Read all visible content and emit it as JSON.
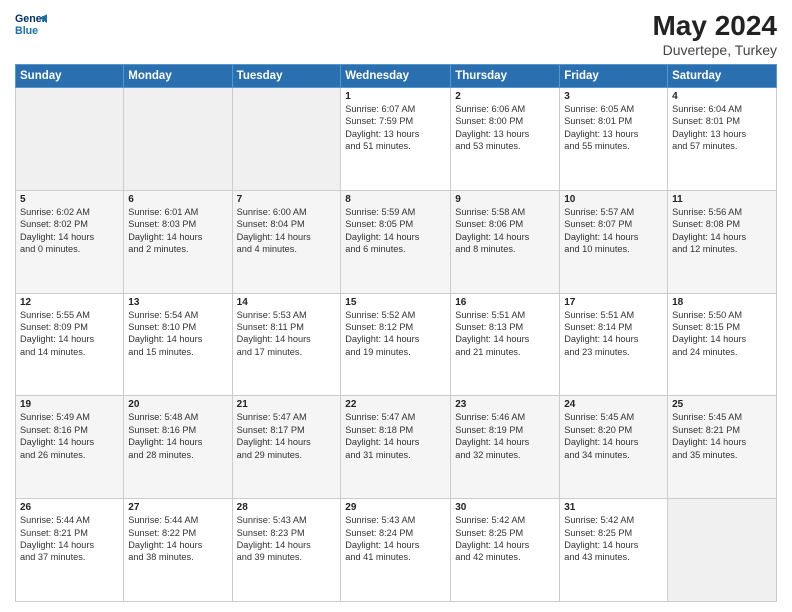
{
  "header": {
    "logo_line1": "General",
    "logo_line2": "Blue",
    "title": "May 2024",
    "location": "Duvertepe, Turkey"
  },
  "columns": [
    "Sunday",
    "Monday",
    "Tuesday",
    "Wednesday",
    "Thursday",
    "Friday",
    "Saturday"
  ],
  "weeks": [
    [
      {
        "day": "",
        "info": ""
      },
      {
        "day": "",
        "info": ""
      },
      {
        "day": "",
        "info": ""
      },
      {
        "day": "1",
        "info": "Sunrise: 6:07 AM\nSunset: 7:59 PM\nDaylight: 13 hours\nand 51 minutes."
      },
      {
        "day": "2",
        "info": "Sunrise: 6:06 AM\nSunset: 8:00 PM\nDaylight: 13 hours\nand 53 minutes."
      },
      {
        "day": "3",
        "info": "Sunrise: 6:05 AM\nSunset: 8:01 PM\nDaylight: 13 hours\nand 55 minutes."
      },
      {
        "day": "4",
        "info": "Sunrise: 6:04 AM\nSunset: 8:01 PM\nDaylight: 13 hours\nand 57 minutes."
      }
    ],
    [
      {
        "day": "5",
        "info": "Sunrise: 6:02 AM\nSunset: 8:02 PM\nDaylight: 14 hours\nand 0 minutes."
      },
      {
        "day": "6",
        "info": "Sunrise: 6:01 AM\nSunset: 8:03 PM\nDaylight: 14 hours\nand 2 minutes."
      },
      {
        "day": "7",
        "info": "Sunrise: 6:00 AM\nSunset: 8:04 PM\nDaylight: 14 hours\nand 4 minutes."
      },
      {
        "day": "8",
        "info": "Sunrise: 5:59 AM\nSunset: 8:05 PM\nDaylight: 14 hours\nand 6 minutes."
      },
      {
        "day": "9",
        "info": "Sunrise: 5:58 AM\nSunset: 8:06 PM\nDaylight: 14 hours\nand 8 minutes."
      },
      {
        "day": "10",
        "info": "Sunrise: 5:57 AM\nSunset: 8:07 PM\nDaylight: 14 hours\nand 10 minutes."
      },
      {
        "day": "11",
        "info": "Sunrise: 5:56 AM\nSunset: 8:08 PM\nDaylight: 14 hours\nand 12 minutes."
      }
    ],
    [
      {
        "day": "12",
        "info": "Sunrise: 5:55 AM\nSunset: 8:09 PM\nDaylight: 14 hours\nand 14 minutes."
      },
      {
        "day": "13",
        "info": "Sunrise: 5:54 AM\nSunset: 8:10 PM\nDaylight: 14 hours\nand 15 minutes."
      },
      {
        "day": "14",
        "info": "Sunrise: 5:53 AM\nSunset: 8:11 PM\nDaylight: 14 hours\nand 17 minutes."
      },
      {
        "day": "15",
        "info": "Sunrise: 5:52 AM\nSunset: 8:12 PM\nDaylight: 14 hours\nand 19 minutes."
      },
      {
        "day": "16",
        "info": "Sunrise: 5:51 AM\nSunset: 8:13 PM\nDaylight: 14 hours\nand 21 minutes."
      },
      {
        "day": "17",
        "info": "Sunrise: 5:51 AM\nSunset: 8:14 PM\nDaylight: 14 hours\nand 23 minutes."
      },
      {
        "day": "18",
        "info": "Sunrise: 5:50 AM\nSunset: 8:15 PM\nDaylight: 14 hours\nand 24 minutes."
      }
    ],
    [
      {
        "day": "19",
        "info": "Sunrise: 5:49 AM\nSunset: 8:16 PM\nDaylight: 14 hours\nand 26 minutes."
      },
      {
        "day": "20",
        "info": "Sunrise: 5:48 AM\nSunset: 8:16 PM\nDaylight: 14 hours\nand 28 minutes."
      },
      {
        "day": "21",
        "info": "Sunrise: 5:47 AM\nSunset: 8:17 PM\nDaylight: 14 hours\nand 29 minutes."
      },
      {
        "day": "22",
        "info": "Sunrise: 5:47 AM\nSunset: 8:18 PM\nDaylight: 14 hours\nand 31 minutes."
      },
      {
        "day": "23",
        "info": "Sunrise: 5:46 AM\nSunset: 8:19 PM\nDaylight: 14 hours\nand 32 minutes."
      },
      {
        "day": "24",
        "info": "Sunrise: 5:45 AM\nSunset: 8:20 PM\nDaylight: 14 hours\nand 34 minutes."
      },
      {
        "day": "25",
        "info": "Sunrise: 5:45 AM\nSunset: 8:21 PM\nDaylight: 14 hours\nand 35 minutes."
      }
    ],
    [
      {
        "day": "26",
        "info": "Sunrise: 5:44 AM\nSunset: 8:21 PM\nDaylight: 14 hours\nand 37 minutes."
      },
      {
        "day": "27",
        "info": "Sunrise: 5:44 AM\nSunset: 8:22 PM\nDaylight: 14 hours\nand 38 minutes."
      },
      {
        "day": "28",
        "info": "Sunrise: 5:43 AM\nSunset: 8:23 PM\nDaylight: 14 hours\nand 39 minutes."
      },
      {
        "day": "29",
        "info": "Sunrise: 5:43 AM\nSunset: 8:24 PM\nDaylight: 14 hours\nand 41 minutes."
      },
      {
        "day": "30",
        "info": "Sunrise: 5:42 AM\nSunset: 8:25 PM\nDaylight: 14 hours\nand 42 minutes."
      },
      {
        "day": "31",
        "info": "Sunrise: 5:42 AM\nSunset: 8:25 PM\nDaylight: 14 hours\nand 43 minutes."
      },
      {
        "day": "",
        "info": ""
      }
    ]
  ]
}
